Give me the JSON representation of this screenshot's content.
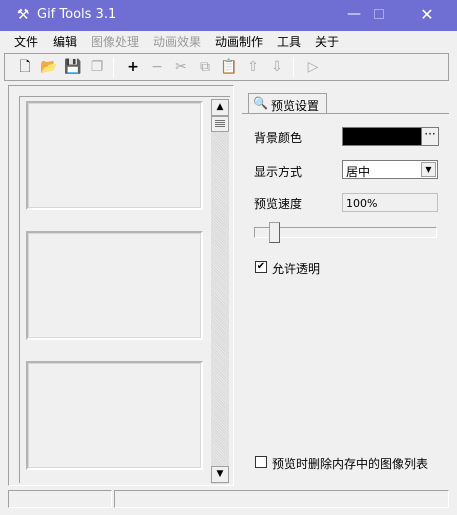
{
  "window": {
    "title": "Gif Tools 3.1",
    "app_icon": "tools-icon",
    "minimize": "—",
    "close": "✕"
  },
  "menu": [
    {
      "label": "文件",
      "enabled": true
    },
    {
      "label": "编辑",
      "enabled": true
    },
    {
      "label": "图像处理",
      "enabled": false
    },
    {
      "label": "动画效果",
      "enabled": false
    },
    {
      "label": "动画制作",
      "enabled": true
    },
    {
      "label": "工具",
      "enabled": true
    },
    {
      "label": "关于",
      "enabled": true
    }
  ],
  "toolbar": {
    "new": "🗋",
    "open": "📂",
    "save": "💾",
    "save_all": "❐",
    "add": "+",
    "remove": "−",
    "cut": "✂",
    "copy": "⧉",
    "paste": "📋",
    "move_up": "⇧",
    "move_down": "⇩",
    "play": "▷"
  },
  "frames": {
    "scroll_up": "▲",
    "scroll_down": "▼"
  },
  "tab": {
    "label": "预览设置",
    "icon": "preview-icon"
  },
  "settings": {
    "bg_color_label": "背景颜色",
    "bg_color_value": "#000000",
    "bg_color_button": "···",
    "display_mode_label": "显示方式",
    "display_mode_value": "居中",
    "display_mode_arrow": "▼",
    "speed_label": "预览速度",
    "speed_value": "100%",
    "allow_transparency_label": "允许透明",
    "allow_transparency_checked": true,
    "allow_transparency_mark": "✔",
    "delete_image_list_label": "预览时删除内存中的图像列表",
    "delete_image_list_checked": false
  }
}
